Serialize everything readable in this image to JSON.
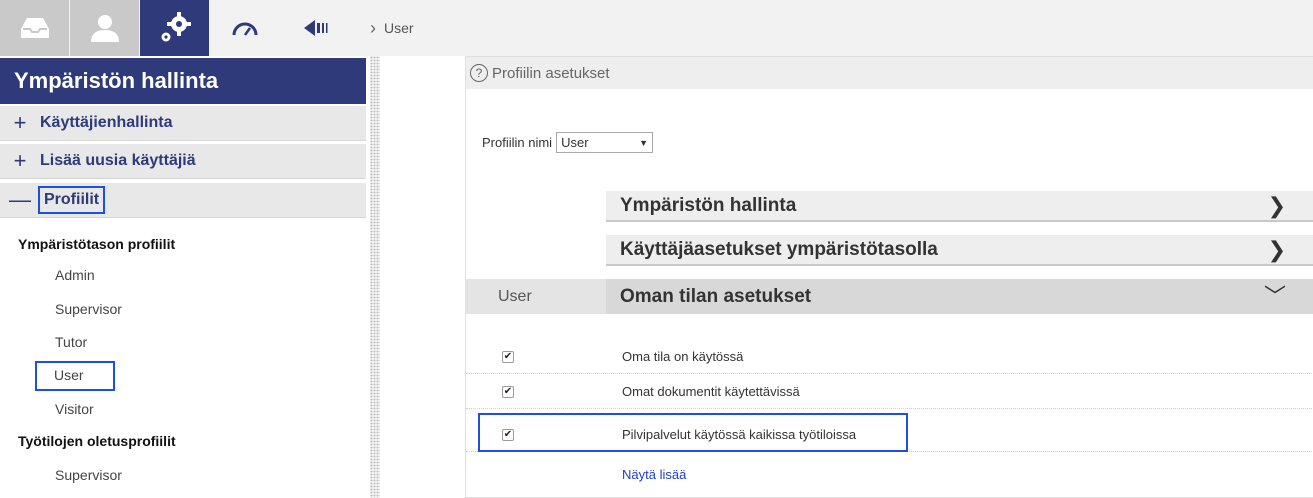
{
  "toolbar": {
    "icons": [
      "inbox-icon",
      "user-icon",
      "gears-icon",
      "speedometer-icon",
      "back-arrow-icon"
    ],
    "breadcrumb_current": "User"
  },
  "sidebar": {
    "title": "Ympäristön hallinta",
    "sections": [
      {
        "symbol": "+",
        "label": "Käyttäjienhallinta"
      },
      {
        "symbol": "+",
        "label": "Lisää uusia käyttäjiä"
      },
      {
        "symbol": "—",
        "label": "Profiilit"
      }
    ],
    "groups": [
      {
        "title": "Ympäristötason profiilit",
        "items": [
          "Admin",
          "Supervisor",
          "Tutor",
          "User",
          "Visitor"
        ]
      },
      {
        "title": "Työtilojen oletusprofiilit",
        "items": [
          "Supervisor"
        ]
      }
    ]
  },
  "main": {
    "panel_title": "Profiilin asetukset",
    "profile_label": "Profiilin nimi",
    "profile_value": "User",
    "accordions": [
      {
        "label": "Ympäristön hallinta",
        "chevron": "❯"
      },
      {
        "label": "Käyttäjäasetukset ympäristötasolla",
        "chevron": "❯"
      },
      {
        "side_label": "User",
        "label": "Oman tilan asetukset",
        "chevron": "﹀"
      }
    ],
    "options": [
      {
        "label": "Oma tila on käytössä",
        "checked": true
      },
      {
        "label": "Omat dokumentit käytettävissä",
        "checked": true
      },
      {
        "label": "Pilvipalvelut käytössä kaikissa työtiloissa",
        "checked": true
      }
    ],
    "show_more": "Näytä lisää"
  },
  "colors": {
    "brand": "#2e3a7a",
    "highlight": "#1f4fe0",
    "link": "#1f3ed0"
  }
}
